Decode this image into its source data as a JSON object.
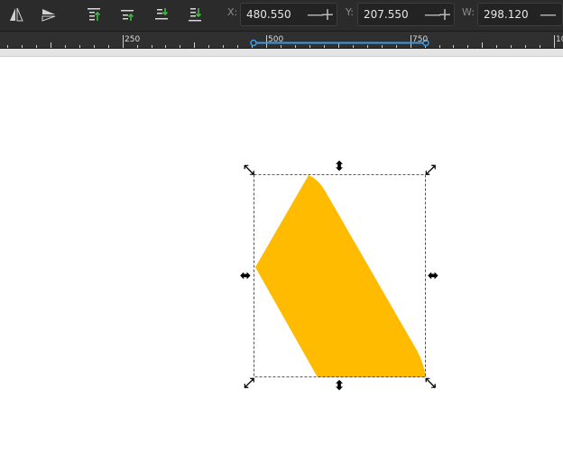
{
  "toolbar": {
    "x_label": "X:",
    "x_value": "480.550",
    "y_label": "Y:",
    "y_value": "207.550",
    "w_label": "W:",
    "w_value": "298.120",
    "minus": "—",
    "plus": "+",
    "icons": [
      "flip-horizontal-icon",
      "flip-vertical-icon",
      "raise-to-top-icon",
      "raise-icon",
      "lower-icon",
      "lower-to-bottom-icon"
    ]
  },
  "ruler": {
    "labels": [
      "250",
      "500",
      "750",
      "10"
    ]
  },
  "shape": {
    "fill": "#ffbb00",
    "selection_color": "#1a1a8a"
  },
  "handles": {
    "corner_symbol": "⤡",
    "corner_symbol_alt": "⤢",
    "vertical_symbol": "⬍",
    "horizontal_symbol": "⬌"
  }
}
